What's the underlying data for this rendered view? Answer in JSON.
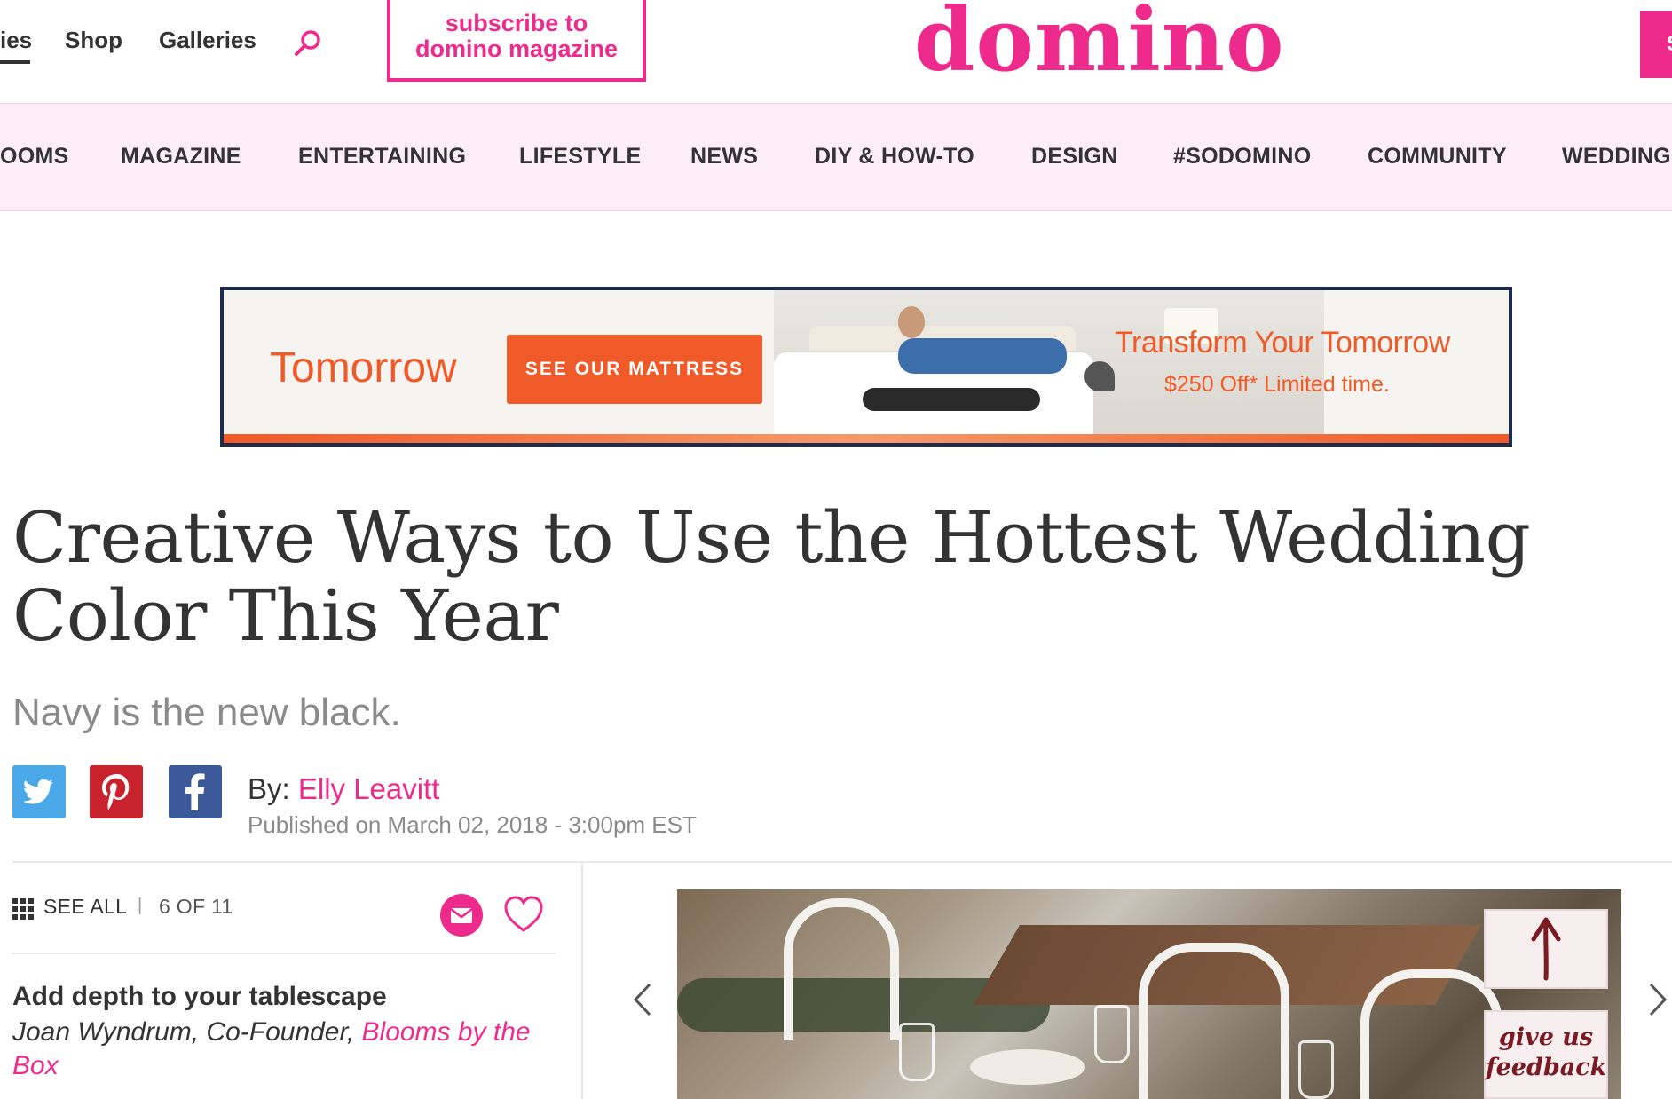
{
  "top_nav": {
    "items": [
      "ies",
      "Shop",
      "Galleries"
    ],
    "search_icon": "search-icon",
    "subscribe_line1": "subscribe to",
    "subscribe_line2": "domino magazine",
    "logo": "domino",
    "right_button": "S"
  },
  "category_nav": [
    "OOMS",
    "MAGAZINE",
    "ENTERTAINING",
    "LIFESTYLE",
    "NEWS",
    "DIY & HOW-TO",
    "DESIGN",
    "#SODOMINO",
    "COMMUNITY",
    "WEDDING"
  ],
  "ad": {
    "brand": "Tomorrow",
    "cta": "SEE OUR MATTRESS",
    "headline": "Transform Your Tomorrow",
    "sub": "$250 Off* Limited time."
  },
  "article": {
    "title": "Creative Ways to Use the Hottest Wedding Color This Year",
    "subtitle": "Navy is the new black.",
    "byline_prefix": "By: ",
    "author": "Elly Leavitt",
    "published": "Published on March 02, 2018 - 3:00pm EST",
    "share_icons": [
      "twitter-icon",
      "pinterest-icon",
      "facebook-icon"
    ]
  },
  "slideshow": {
    "see_all": "SEE ALL",
    "separator": "|",
    "counter": "6 OF 11",
    "heading": "Add depth to your tablescape",
    "credit_text": "Joan Wyndrum, Co-Founder, ",
    "credit_link": "Blooms by the Box",
    "feedback_line1": "give us",
    "feedback_line2": "feedback"
  },
  "colors": {
    "brand_pink": "#ee2a8c",
    "nav_bg": "#fdeef5",
    "ad_orange": "#f05a28",
    "twitter": "#4aa8e8",
    "pinterest": "#c8232c",
    "facebook": "#3b5998"
  }
}
